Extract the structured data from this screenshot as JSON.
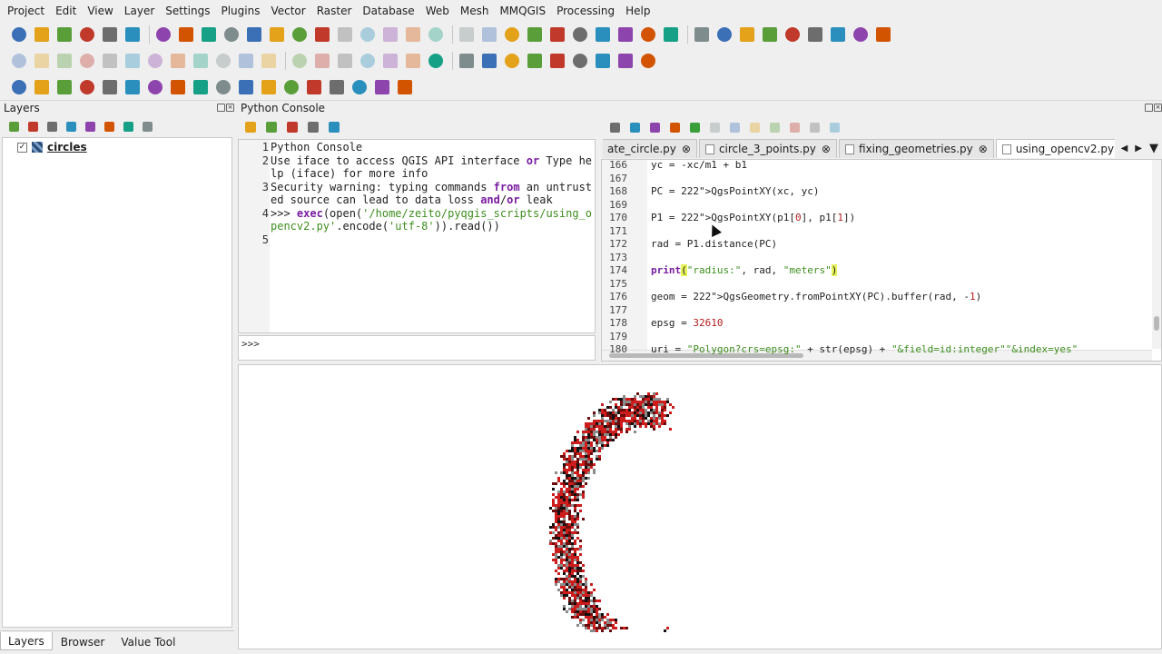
{
  "menubar": {
    "items": [
      "Project",
      "Edit",
      "View",
      "Layer",
      "Settings",
      "Plugins",
      "Vector",
      "Raster",
      "Database",
      "Web",
      "Mesh",
      "MMQGIS",
      "Processing",
      "Help"
    ]
  },
  "toolbars": {
    "row1": [
      "new-project-icon",
      "open-project-icon",
      "save-project-icon",
      "save-as-icon",
      "print-layout-icon",
      "style-manager-icon",
      "pan-icon",
      "pan-to-selection-icon",
      "zoom-in-icon",
      "zoom-out-icon",
      "zoom-full-icon",
      "zoom-to-selection-icon",
      "zoom-to-layer-icon",
      "zoom-native-icon",
      "zoom-last-icon",
      "zoom-next-icon",
      "new-map-view-icon",
      "temporal-controller-icon",
      "refresh-icon",
      "identify-icon",
      "run-action-icon",
      "select-features-icon",
      "deselect-icon",
      "open-attribute-table-icon",
      "field-calculator-icon",
      "statistics-icon",
      "measure-icon",
      "map-tips-icon",
      "text-annotation-icon",
      "digitize-icon",
      "georeferencer-icon",
      "coordinate-capture-icon",
      "gps-icon",
      "node-tool-icon",
      "wkt-plugin-icon",
      "globe-icon",
      "web-icon",
      "processing-icon"
    ],
    "row2": [
      "current-edits-icon",
      "toggle-editing-icon",
      "save-edits-icon",
      "digitize-icon",
      "add-feature-icon",
      "move-feature-icon",
      "delete-icon",
      "cut-icon",
      "copy-icon",
      "paste-icon",
      "undo-icon",
      "redo-icon",
      "label-tool-icon",
      "pin-label-icon",
      "highlight-label-icon",
      "show-label-icon",
      "move-label-icon",
      "rotate-label-icon",
      "change-label-icon",
      "python-console-icon",
      "text-icon",
      "rotate-icon",
      "add-vector-layer-icon",
      "plugin-icon",
      "quick-osm-icon",
      "wkt-icon",
      "help-icon",
      "settings-icon"
    ],
    "row3": [
      "map-swipe-icon",
      "data-plotly-icon",
      "book-icon",
      "airplane-icon",
      "tri-shapes-icon",
      "fire-icon",
      "spiral-icon",
      "raster-icon",
      "tools-icon",
      "terrain-icon",
      "grid-icon",
      "search-icon",
      "network-icon",
      "q-plugin-icon",
      "wms-icon",
      "blue-square-icon",
      "pencil-image-icon",
      "green-leaf-icon"
    ]
  },
  "layers_panel": {
    "title": "Layers",
    "layers": [
      {
        "name": "circles",
        "checked": true
      }
    ],
    "bottom_tabs": [
      "Layers",
      "Browser",
      "Value Tool"
    ]
  },
  "python_console": {
    "title": "Python Console",
    "output_lines": [
      {
        "n": "1",
        "text": "Python Console"
      },
      {
        "n": "2",
        "text": "Use iface to access QGIS API interface or Type help (iface) for more info"
      },
      {
        "n": "3",
        "text": "Security warning: typing commands from an untrusted source can lead to data loss and/or leak"
      },
      {
        "n": "4",
        "text": ">>> exec(open('/home/zeito/pyqgis_scripts/using_opencv2.py'.encode('utf-8')).read())"
      },
      {
        "n": "5",
        "text": ""
      }
    ],
    "prompt": ">>>"
  },
  "editor": {
    "tabs": [
      "ate_circle.py",
      "circle_3_points.py",
      "fixing_geometries.py",
      "using_opencv2.py"
    ],
    "active_tab": 3,
    "lines": [
      {
        "n": "166",
        "text": "yc = -xc/m1 + b1"
      },
      {
        "n": "167",
        "text": ""
      },
      {
        "n": "168",
        "text": "PC = QgsPointXY(xc, yc)"
      },
      {
        "n": "169",
        "text": ""
      },
      {
        "n": "170",
        "text": "P1 = QgsPointXY(p1[0], p1[1])"
      },
      {
        "n": "171",
        "text": ""
      },
      {
        "n": "172",
        "text": "rad = P1.distance(PC)"
      },
      {
        "n": "173",
        "text": ""
      },
      {
        "n": "174",
        "text": "print(\"radius:\", rad, \"meters\")"
      },
      {
        "n": "175",
        "text": ""
      },
      {
        "n": "176",
        "text": "geom = QgsGeometry.fromPointXY(PC).buffer(rad, -1)"
      },
      {
        "n": "177",
        "text": ""
      },
      {
        "n": "178",
        "text": "epsg = 32610"
      },
      {
        "n": "179",
        "text": ""
      },
      {
        "n": "180",
        "text": "uri = \"Polygon?crs=epsg:\" + str(epsg) + \"&field=id:integer\"\"&index=yes\""
      }
    ]
  },
  "map": {
    "colors": {
      "red": "#cc1c1c",
      "dark_red": "#6b0c0c",
      "gray": "#8a8a8a",
      "black": "#111111"
    }
  }
}
